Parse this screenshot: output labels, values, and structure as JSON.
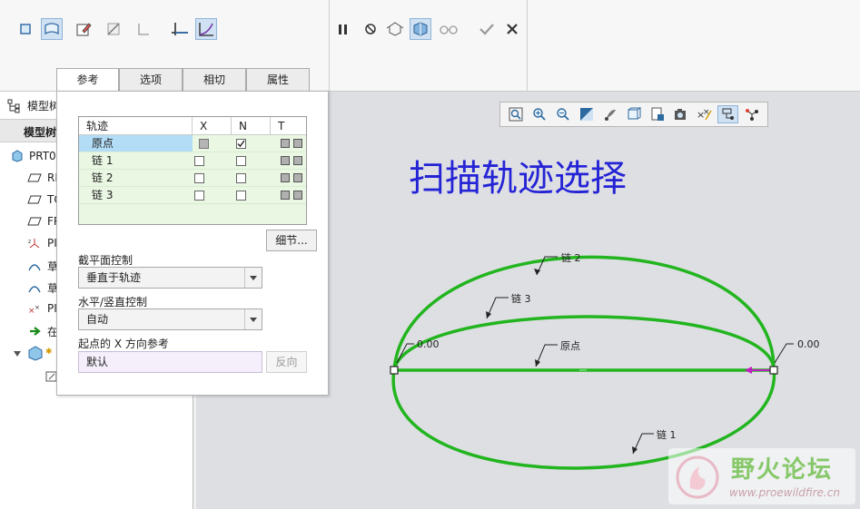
{
  "ribbon": {
    "group1_icons": [
      "solid-icon",
      "surface-icon",
      "sketch-edit-icon",
      "remove-material-icon",
      "thicken-icon",
      "constant-section-icon",
      "variable-section-icon"
    ],
    "group2_icons": [
      "pause-icon",
      "no-preview-icon",
      "preview-icon",
      "verify-icon",
      "glasses-icon",
      "ok-icon",
      "cancel-icon"
    ]
  },
  "tabs": [
    {
      "label": "参考",
      "active": true
    },
    {
      "label": "选项",
      "active": false
    },
    {
      "label": "相切",
      "active": false
    },
    {
      "label": "属性",
      "active": false
    }
  ],
  "tree": {
    "header1": "模型树",
    "header2": "模型树",
    "root": "PRT0",
    "items": [
      "RI",
      "TO",
      "FR",
      "PI",
      "草",
      "草",
      "PI",
      "在"
    ]
  },
  "panel": {
    "grid": {
      "headers": [
        "轨迹",
        "X",
        "N",
        "T"
      ],
      "rows": [
        {
          "name": "原点",
          "x": "gray",
          "n": true,
          "selected": true
        },
        {
          "name": "链 1",
          "x": false,
          "n": false,
          "selected": false
        },
        {
          "name": "链 2",
          "x": false,
          "n": false,
          "selected": false
        },
        {
          "name": "链 3",
          "x": false,
          "n": false,
          "selected": false
        }
      ]
    },
    "details_button": "细节...",
    "section_label": "截平面控制",
    "section_value": "垂直于轨迹",
    "hv_label": "水平/竖直控制",
    "hv_value": "自动",
    "xdir_label": "起点的 X 方向参考",
    "xdir_value": "默认",
    "flip_button": "反向"
  },
  "viewport": {
    "title": "扫描轨迹选择",
    "labels": {
      "chain1": "链 1",
      "chain2": "链 2",
      "chain3": "链 3",
      "origin": "原点",
      "left_value": "0.00",
      "right_value": "0.00"
    },
    "watermark_cn": "野火论坛",
    "watermark_url": "www.proewildfire.cn",
    "colors": {
      "curve": "#22b51f",
      "title": "#2424d6",
      "arrow": "#c020c0"
    }
  }
}
